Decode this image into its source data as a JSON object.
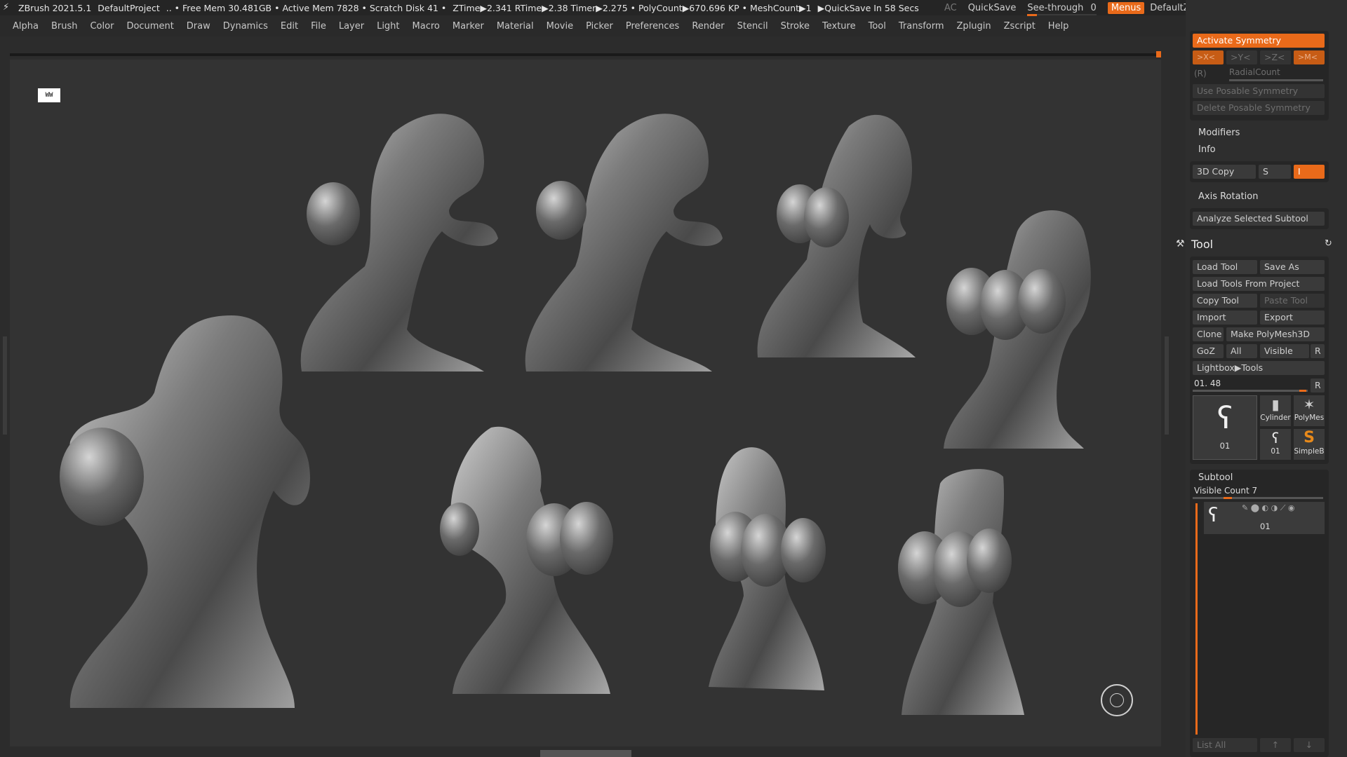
{
  "titlebar": {
    "app": "ZBrush 2021.5.1",
    "project": "DefaultProject",
    "stats": ".. • Free Mem 30.481GB • Active Mem 7828 • Scratch Disk 41 •",
    "ztime": "ZTime▶2.341 RTime▶2.38 Timer▶2.275 • PolyCount▶670.696 KP • MeshCount▶1",
    "quicksave_timer": "▶QuickSave In 58 Secs",
    "ac": "AC",
    "quicksave": "QuickSave",
    "see_through": "See-through",
    "see_through_value": "0",
    "menus": "Menus",
    "script": "DefaultZScript"
  },
  "menubar": [
    "Alpha",
    "Brush",
    "Color",
    "Document",
    "Draw",
    "Dynamics",
    "Edit",
    "File",
    "Layer",
    "Light",
    "Macro",
    "Marker",
    "Material",
    "Movie",
    "Picker",
    "Preferences",
    "Render",
    "Stencil",
    "Stroke",
    "Texture",
    "Tool",
    "Transform",
    "Zplugin",
    "Zscript",
    "Help"
  ],
  "viewport": {
    "icon_label": "WW"
  },
  "panel": {
    "activate_symmetry": "Activate Symmetry",
    "axes": [
      ">X<",
      ">Y<",
      ">Z<",
      ">M<"
    ],
    "r_label": "(R)",
    "radial_count": "RadialCount",
    "use_posable": "Use Posable Symmetry",
    "delete_posable": "Delete Posable Symmetry",
    "modifiers": "Modifiers",
    "info": "Info",
    "copy3d": "3D Copy",
    "s": "S",
    "i": "I",
    "axis_rotation": "Axis Rotation",
    "analyze": "Analyze Selected Subtool",
    "tool_title": "Tool",
    "load_tool": "Load Tool",
    "save_as": "Save As",
    "load_from_project": "Load Tools From Project",
    "copy_tool": "Copy Tool",
    "paste_tool": "Paste Tool",
    "import": "Import",
    "export": "Export",
    "clone": "Clone",
    "make_polymesh": "Make PolyMesh3D",
    "goz": "GoZ",
    "all": "All",
    "visible": "Visible",
    "r": "R",
    "lightbox_tools": "Lightbox▶Tools",
    "tool_slider": "01. 48",
    "thumbs": [
      "01",
      "Cylinder",
      "PolyMes",
      "01",
      "SimpleB"
    ],
    "subtool": "Subtool",
    "visible_count": "Visible Count 7",
    "subtool_item": "01",
    "list_all": "List All"
  }
}
